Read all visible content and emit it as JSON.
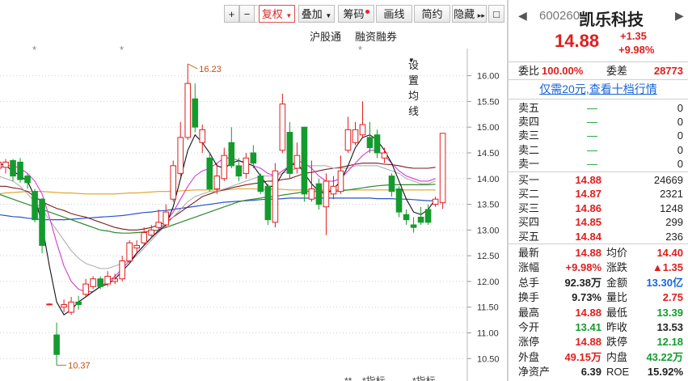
{
  "toolbar": {
    "zoom_in": "+",
    "zoom_out": "−",
    "square": "□",
    "restore_rights": "复权",
    "stack": "叠加",
    "chips": "筹码",
    "draw_line": "画线",
    "simple": "简约",
    "hide": "隐藏",
    "more": "▸▸"
  },
  "subtoolbar": {
    "hsgt": "沪股通",
    "margin": "融资融券",
    "ma_settings": "设置均线"
  },
  "chart_markers": {
    "star1": "*",
    "star2": "*",
    "star3": "*"
  },
  "chart_data": {
    "type": "candlestick",
    "y_ticks": [
      "16.00",
      "15.50",
      "15.00",
      "14.50",
      "14.00",
      "13.50",
      "13.00",
      "12.50",
      "12.00",
      "11.50",
      "11.00",
      "10.50"
    ],
    "ylim": [
      10.3,
      16.45
    ],
    "high_label": "16.23",
    "low_label": "10.37",
    "bottom_labels": [
      "**",
      "*指标",
      "*指标"
    ],
    "candles": [
      {
        "o": 14.2,
        "c": 14.32,
        "h": 14.35,
        "l": 14.05
      },
      {
        "o": 14.22,
        "c": 14.32,
        "h": 14.38,
        "l": 14.1
      },
      {
        "o": 14.35,
        "c": 14.05,
        "h": 14.38,
        "l": 13.95
      },
      {
        "o": 14.32,
        "c": 13.98,
        "h": 14.4,
        "l": 13.92
      },
      {
        "o": 14.05,
        "c": 13.92,
        "h": 14.1,
        "l": 13.8
      },
      {
        "o": 13.75,
        "c": 13.2,
        "h": 13.8,
        "l": 13.15
      },
      {
        "o": 13.6,
        "c": 12.7,
        "h": 13.62,
        "l": 12.55
      },
      {
        "o": 11.56,
        "c": 11.56,
        "h": 11.58,
        "l": 11.54
      },
      {
        "o": 10.96,
        "c": 10.58,
        "h": 11.2,
        "l": 10.37
      },
      {
        "o": 11.5,
        "c": 11.55,
        "h": 11.65,
        "l": 11.4
      },
      {
        "o": 11.4,
        "c": 11.6,
        "h": 11.7,
        "l": 11.35
      },
      {
        "o": 11.6,
        "c": 11.55,
        "h": 11.72,
        "l": 11.45
      },
      {
        "o": 11.75,
        "c": 11.95,
        "h": 12.05,
        "l": 11.7
      },
      {
        "o": 11.9,
        "c": 12.05,
        "h": 12.1,
        "l": 11.85
      },
      {
        "o": 12.05,
        "c": 11.9,
        "h": 12.1,
        "l": 11.85
      },
      {
        "o": 11.95,
        "c": 12.1,
        "h": 12.2,
        "l": 11.9
      },
      {
        "o": 12.0,
        "c": 12.05,
        "h": 12.15,
        "l": 11.95
      },
      {
        "o": 12.05,
        "c": 12.4,
        "h": 12.5,
        "l": 12.0
      },
      {
        "o": 12.4,
        "c": 12.75,
        "h": 12.8,
        "l": 12.35
      },
      {
        "o": 12.65,
        "c": 12.7,
        "h": 12.8,
        "l": 12.55
      },
      {
        "o": 12.75,
        "c": 12.95,
        "h": 13.05,
        "l": 12.7
      },
      {
        "o": 12.9,
        "c": 13.0,
        "h": 13.1,
        "l": 12.85
      },
      {
        "o": 13.05,
        "c": 13.15,
        "h": 13.4,
        "l": 13.0
      },
      {
        "o": 13.1,
        "c": 13.35,
        "h": 13.5,
        "l": 13.05
      },
      {
        "o": 13.6,
        "c": 14.25,
        "h": 14.35,
        "l": 13.55
      },
      {
        "o": 14.1,
        "c": 14.8,
        "h": 15.1,
        "l": 14.05
      },
      {
        "o": 14.8,
        "c": 15.85,
        "h": 16.23,
        "l": 14.75
      },
      {
        "o": 15.55,
        "c": 15.0,
        "h": 15.85,
        "l": 14.9
      },
      {
        "o": 14.7,
        "c": 14.95,
        "h": 15.05,
        "l": 14.5
      },
      {
        "o": 14.4,
        "c": 13.8,
        "h": 14.5,
        "l": 13.75
      },
      {
        "o": 13.8,
        "c": 14.05,
        "h": 14.3,
        "l": 13.7
      },
      {
        "o": 14.0,
        "c": 14.45,
        "h": 14.6,
        "l": 13.95
      },
      {
        "o": 14.7,
        "c": 14.25,
        "h": 15.0,
        "l": 14.2
      },
      {
        "o": 14.25,
        "c": 14.05,
        "h": 14.4,
        "l": 13.95
      },
      {
        "o": 14.1,
        "c": 14.4,
        "h": 14.5,
        "l": 14.0
      },
      {
        "o": 14.5,
        "c": 14.3,
        "h": 14.65,
        "l": 14.2
      },
      {
        "o": 14.05,
        "c": 13.75,
        "h": 14.1,
        "l": 13.7
      },
      {
        "o": 13.85,
        "c": 13.2,
        "h": 13.9,
        "l": 13.1
      },
      {
        "o": 13.15,
        "c": 14.15,
        "h": 14.3,
        "l": 13.05
      },
      {
        "o": 14.55,
        "c": 15.45,
        "h": 15.65,
        "l": 14.5
      },
      {
        "o": 14.9,
        "c": 14.1,
        "h": 15.1,
        "l": 14.0
      },
      {
        "o": 14.2,
        "c": 14.45,
        "h": 14.7,
        "l": 14.1
      },
      {
        "o": 15.0,
        "c": 13.7,
        "h": 15.0,
        "l": 13.55
      },
      {
        "o": 13.6,
        "c": 13.8,
        "h": 14.35,
        "l": 13.55
      },
      {
        "o": 13.9,
        "c": 13.5,
        "h": 14.0,
        "l": 13.4
      },
      {
        "o": 13.45,
        "c": 13.95,
        "h": 14.1,
        "l": 12.9
      },
      {
        "o": 13.7,
        "c": 13.85,
        "h": 14.05,
        "l": 13.6
      },
      {
        "o": 13.75,
        "c": 14.15,
        "h": 14.45,
        "l": 13.7
      },
      {
        "o": 14.55,
        "c": 14.95,
        "h": 15.2,
        "l": 14.5
      },
      {
        "o": 14.7,
        "c": 14.95,
        "h": 15.1,
        "l": 14.65
      },
      {
        "o": 14.85,
        "c": 15.05,
        "h": 15.5,
        "l": 14.8
      },
      {
        "o": 14.8,
        "c": 14.6,
        "h": 15.1,
        "l": 14.5
      },
      {
        "o": 14.85,
        "c": 14.5,
        "h": 14.95,
        "l": 14.4
      },
      {
        "o": 14.4,
        "c": 14.5,
        "h": 14.6,
        "l": 14.3
      },
      {
        "o": 14.05,
        "c": 13.75,
        "h": 14.1,
        "l": 13.65
      },
      {
        "o": 13.8,
        "c": 13.35,
        "h": 13.85,
        "l": 13.25
      },
      {
        "o": 13.3,
        "c": 13.2,
        "h": 13.4,
        "l": 13.1
      },
      {
        "o": 13.1,
        "c": 13.05,
        "h": 13.25,
        "l": 12.95
      },
      {
        "o": 13.25,
        "c": 13.15,
        "h": 13.45,
        "l": 13.1
      },
      {
        "o": 13.4,
        "c": 13.15,
        "h": 13.5,
        "l": 13.1
      },
      {
        "o": 13.5,
        "c": 13.6,
        "h": 13.65,
        "l": 13.45
      },
      {
        "o": 13.53,
        "c": 14.88,
        "h": 14.88,
        "l": 13.41
      }
    ],
    "ma_black": [
      14.3,
      14.25,
      14.15,
      14.05,
      13.95,
      13.65,
      13.1,
      12.3,
      11.6,
      11.35,
      11.45,
      11.6,
      11.7,
      11.8,
      11.9,
      11.95,
      12.05,
      12.2,
      12.35,
      12.55,
      12.7,
      12.85,
      12.98,
      13.1,
      13.45,
      14.0,
      14.55,
      14.85,
      14.7,
      14.5,
      14.25,
      14.2,
      14.3,
      14.35,
      14.3,
      14.25,
      14.05,
      13.85,
      13.85,
      14.1,
      14.25,
      14.3,
      14.1,
      13.9,
      13.75,
      13.7,
      13.8,
      13.95,
      14.25,
      14.6,
      14.8,
      14.85,
      14.75,
      14.55,
      14.3,
      13.95,
      13.6,
      13.35,
      13.3,
      13.4,
      13.6
    ],
    "ma_magenta": [
      14.2,
      14.25,
      14.25,
      14.2,
      14.1,
      13.95,
      13.7,
      13.25,
      12.75,
      12.3,
      12.0,
      11.85,
      11.8,
      11.8,
      11.9,
      12.0,
      12.1,
      12.25,
      12.4,
      12.55,
      12.7,
      12.85,
      13.0,
      13.15,
      13.35,
      13.6,
      13.85,
      14.05,
      14.15,
      14.2,
      14.3,
      14.4,
      14.4,
      14.35,
      14.3,
      14.25,
      14.2,
      14.1,
      14.05,
      14.15,
      14.25,
      14.35,
      14.3,
      14.2,
      14.05,
      13.95,
      13.95,
      14.0,
      14.15,
      14.3,
      14.45,
      14.55,
      14.55,
      14.45,
      14.3,
      14.15,
      14.05,
      14.0,
      13.95,
      13.95,
      14.0
    ],
    "ma_gray": [
      14.05,
      14.0,
      13.95,
      13.85,
      13.7,
      13.55,
      13.4,
      13.2,
      13.0,
      12.8,
      12.6,
      12.45,
      12.35,
      12.3,
      12.25,
      12.25,
      12.3,
      12.35,
      12.4,
      12.5,
      12.65,
      12.8,
      12.95,
      13.1,
      13.25,
      13.4,
      13.55,
      13.65,
      13.7,
      13.75,
      13.75,
      13.8,
      13.85,
      13.9,
      13.95,
      14.0,
      14.05,
      14.05,
      14.05,
      14.1,
      14.15,
      14.2,
      14.25,
      14.25,
      14.25,
      14.25,
      14.2,
      14.2,
      14.2,
      14.25,
      14.25,
      14.25,
      14.25,
      14.2,
      14.15,
      14.1,
      14.0,
      13.95,
      13.9,
      13.9,
      13.95
    ],
    "ma_maroon": [
      13.85,
      13.85,
      13.82,
      13.8,
      13.75,
      13.65,
      13.55,
      13.48,
      13.42,
      13.38,
      13.32,
      13.28,
      13.25,
      13.2,
      13.15,
      13.1,
      13.05,
      13.02,
      13.0,
      13.0,
      13.02,
      13.05,
      13.1,
      13.15,
      13.25,
      13.35,
      13.45,
      13.55,
      13.65,
      13.7,
      13.75,
      13.78,
      13.82,
      13.85,
      13.88,
      13.9,
      13.92,
      13.95,
      13.95,
      13.98,
      14.0,
      14.05,
      14.1,
      14.12,
      14.15,
      14.18,
      14.2,
      14.22,
      14.25,
      14.28,
      14.3,
      14.3,
      14.3,
      14.28,
      14.27,
      14.25,
      14.22,
      14.2,
      14.2,
      14.2,
      14.22
    ],
    "ma_orange": [
      13.7,
      13.72,
      13.73,
      13.74,
      13.75,
      13.75,
      13.75,
      13.74,
      13.73,
      13.72,
      13.72,
      13.71,
      13.7,
      13.7,
      13.7,
      13.7,
      13.7,
      13.71,
      13.72,
      13.72,
      13.73,
      13.74,
      13.75,
      13.75,
      13.75,
      13.76,
      13.77,
      13.78,
      13.78,
      13.78,
      13.78,
      13.78,
      13.79,
      13.8,
      13.8,
      13.8,
      13.79,
      13.79,
      13.79,
      13.79,
      13.78,
      13.78,
      13.78,
      13.78,
      13.78,
      13.78,
      13.78,
      13.78,
      13.78,
      13.78,
      13.78,
      13.78,
      13.78,
      13.78,
      13.78,
      13.78,
      13.78,
      13.78,
      13.78,
      13.78,
      13.78
    ],
    "ma_blue": [
      13.3,
      13.28,
      13.26,
      13.25,
      13.23,
      13.22,
      13.2,
      13.2,
      13.2,
      13.2,
      13.21,
      13.22,
      13.23,
      13.24,
      13.25,
      13.26,
      13.27,
      13.28,
      13.3,
      13.32,
      13.34,
      13.35,
      13.37,
      13.38,
      13.4,
      13.42,
      13.44,
      13.46,
      13.48,
      13.5,
      13.52,
      13.54,
      13.55,
      13.56,
      13.57,
      13.58,
      13.59,
      13.6,
      13.6,
      13.61,
      13.62,
      13.62,
      13.62,
      13.62,
      13.62,
      13.62,
      13.62,
      13.62,
      13.62,
      13.62,
      13.62,
      13.62,
      13.61,
      13.61,
      13.61,
      13.6,
      13.6,
      13.59,
      13.58,
      13.57,
      13.57
    ],
    "ma_green": [
      13.7,
      13.65,
      13.6,
      13.55,
      13.5,
      13.45,
      13.4,
      13.35,
      13.3,
      13.25,
      13.2,
      13.15,
      13.1,
      13.05,
      13.0,
      12.98,
      12.95,
      12.94,
      12.94,
      12.95,
      12.96,
      12.98,
      13.0,
      13.05,
      13.1,
      13.15,
      13.2,
      13.25,
      13.3,
      13.35,
      13.4,
      13.45,
      13.5,
      13.55,
      13.58,
      13.6,
      13.62,
      13.65,
      13.65,
      13.68,
      13.7,
      13.72,
      13.75,
      13.75,
      13.75,
      13.75,
      13.75,
      13.76,
      13.78,
      13.8,
      13.82,
      13.84,
      13.86,
      13.87,
      13.88,
      13.88,
      13.88,
      13.88,
      13.88,
      13.88,
      13.89
    ]
  },
  "quote": {
    "code": "600260",
    "name": "凯乐科技",
    "price": "14.88",
    "change": "+1.35",
    "change_pct": "+9.98%",
    "prev_arrow": "◀",
    "next_arrow": "▶",
    "wei_bi_label": "委比",
    "wei_bi": "100.00%",
    "wei_cha_label": "委差",
    "wei_cha": "28773",
    "level10_link": "仅需20元,查看十档行情"
  },
  "order_book": {
    "asks": [
      {
        "label": "卖五",
        "price": "—",
        "vol": "0"
      },
      {
        "label": "卖四",
        "price": "—",
        "vol": "0"
      },
      {
        "label": "卖三",
        "price": "—",
        "vol": "0"
      },
      {
        "label": "卖二",
        "price": "—",
        "vol": "0"
      },
      {
        "label": "卖一",
        "price": "—",
        "vol": "0"
      }
    ],
    "bids": [
      {
        "label": "买一",
        "price": "14.88",
        "vol": "24669"
      },
      {
        "label": "买二",
        "price": "14.87",
        "vol": "2321"
      },
      {
        "label": "买三",
        "price": "14.86",
        "vol": "1248"
      },
      {
        "label": "买四",
        "price": "14.85",
        "vol": "299"
      },
      {
        "label": "买五",
        "price": "14.84",
        "vol": "236"
      }
    ]
  },
  "stats": [
    {
      "l1": "最新",
      "v1": "14.88",
      "c1": "#e01d1d",
      "l2": "均价",
      "v2": "14.40",
      "c2": "#e01d1d"
    },
    {
      "l1": "涨幅",
      "v1": "+9.98%",
      "c1": "#e01d1d",
      "l2": "涨跌",
      "v2": "▲1.35",
      "c2": "#e01d1d"
    },
    {
      "l1": "总手",
      "v1": "92.38万",
      "c1": "#222222",
      "l2": "金额",
      "v2": "13.30亿",
      "c2": "#1a66d8"
    },
    {
      "l1": "换手",
      "v1": "9.73%",
      "c1": "#222222",
      "l2": "量比",
      "v2": "2.75",
      "c2": "#e01d1d"
    },
    {
      "l1": "最高",
      "v1": "14.88",
      "c1": "#e01d1d",
      "l2": "最低",
      "v2": "13.39",
      "c2": "#149b2e"
    },
    {
      "l1": "今开",
      "v1": "13.41",
      "c1": "#149b2e",
      "l2": "昨收",
      "v2": "13.53",
      "c2": "#222222"
    },
    {
      "l1": "涨停",
      "v1": "14.88",
      "c1": "#e01d1d",
      "l2": "跌停",
      "v2": "12.18",
      "c2": "#149b2e"
    },
    {
      "l1": "外盘",
      "v1": "49.15万",
      "c1": "#e01d1d",
      "l2": "内盘",
      "v2": "43.22万",
      "c2": "#149b2e"
    },
    {
      "l1": "净资产",
      "v1": "6.39",
      "c1": "#222222",
      "l2": "ROE",
      "v2": "15.92%",
      "c2": "#222222"
    }
  ],
  "colors": {
    "up": "#e01d1d",
    "down": "#149b2e",
    "link": "#1a66d8"
  }
}
